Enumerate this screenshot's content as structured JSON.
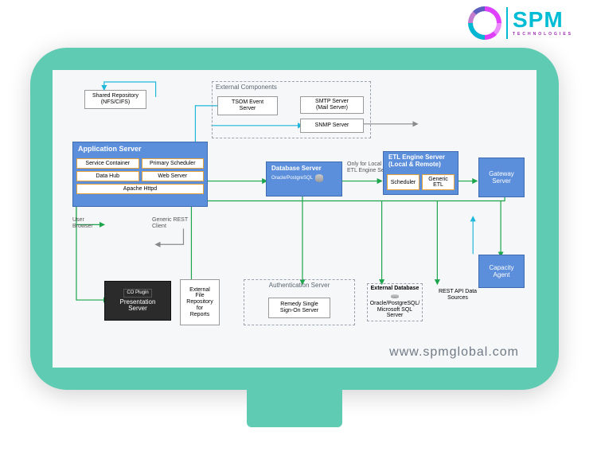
{
  "logo": {
    "text": "SPM",
    "tag": "TECHNOLOGIES"
  },
  "footer": "www.spmglobal.com",
  "labels": {
    "shared_repo": "Shared Repository\n(NFS/CIFS)",
    "user_browser": "User\nBrowser",
    "generic_rest": "Generic REST\nClient",
    "only_for": "Only for Local\nETL Engine Server"
  },
  "ext_comp": {
    "title": "External Components",
    "tsom": "TSOM Event\nServer",
    "smtp": "SMTP Server\n(Mail Server)",
    "snmp": "SNMP Server"
  },
  "app_server": {
    "title": "Application Server",
    "p1": "Service Container",
    "p2": "Primary Scheduler",
    "p3": "Data Hub",
    "p4": "Web Server",
    "p5": "Apache Httpd"
  },
  "db_server": {
    "title": "Database Server",
    "sub": "Oracle/PostgreSQL"
  },
  "etl": {
    "title": "ETL Engine Server\n(Local & Remote)",
    "p1": "Scheduler",
    "p2": "Generic ETL"
  },
  "gateway": "Gateway\nServer",
  "capacity": "Capacity\nAgent",
  "pres": {
    "plugin": "CO Plugin",
    "title": "Presentation\nServer"
  },
  "auth": {
    "title": "Authentication Server",
    "sub": "Remedy Single\nSign-On Server"
  },
  "ext_db": {
    "title": "External Database",
    "sub": "Oracle/PostgreSQL/\nMicrosoft SQL Server"
  },
  "rest_api": "REST API Data\nSources",
  "file_repo": "External\nFile\nRepository\nfor\nReports"
}
